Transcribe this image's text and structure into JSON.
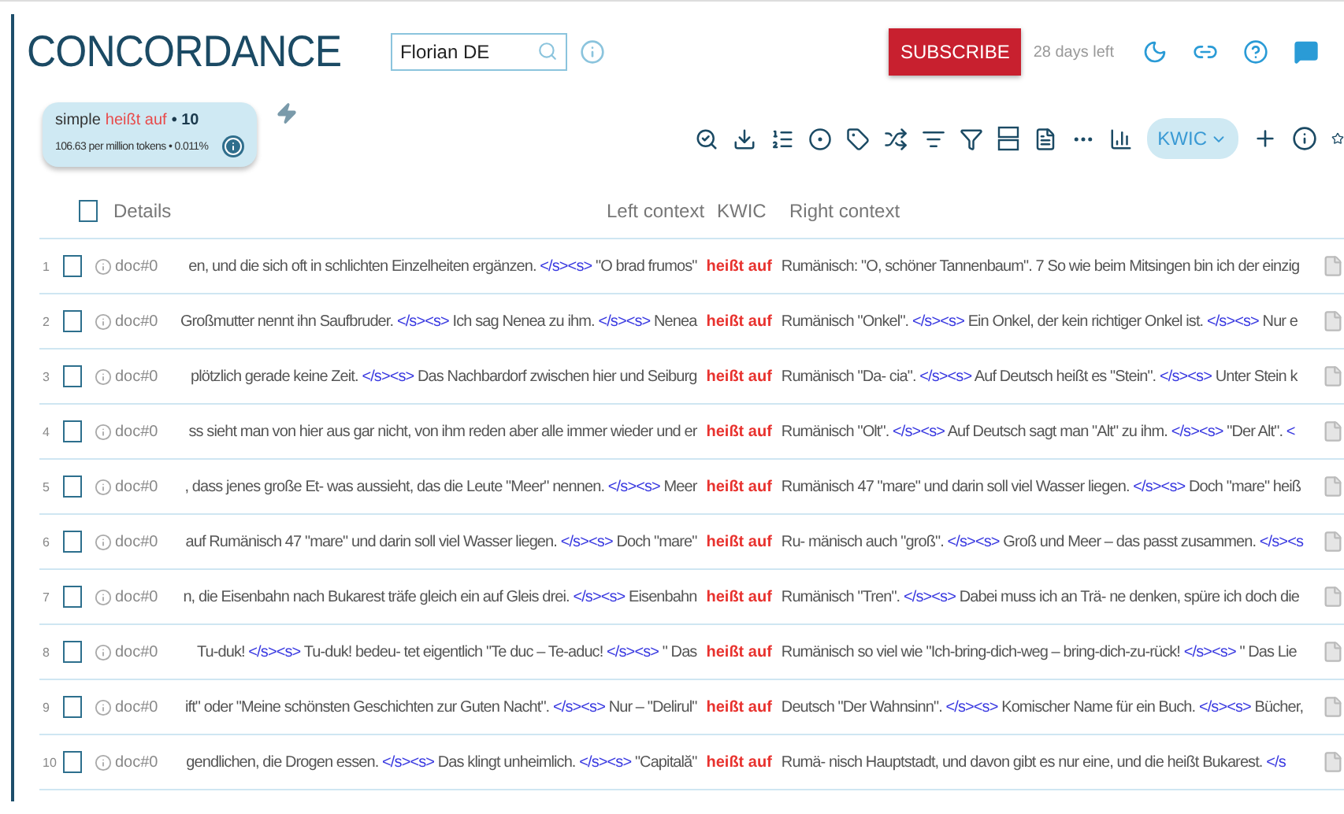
{
  "header": {
    "title": "CONCORDANCE",
    "search": {
      "value": "Florian DE"
    },
    "subscribe": "SUBSCRIBE",
    "trial": "28 days left"
  },
  "summary": {
    "query_type": "simple",
    "query": "heißt auf",
    "hits": "• 10",
    "stats": "106.63 per million tokens • 0.011%"
  },
  "view_mode": "KWIC",
  "table": {
    "columns": {
      "details": "Details",
      "left": "Left context",
      "kwic": "KWIC",
      "right": "Right context"
    },
    "select_all_checked": false,
    "rows": [
      {
        "number": "1",
        "checked": false,
        "doc": "doc#0",
        "left": [
          {
            "kind": "text",
            "text": "en, und die sich oft in schlichten Einzelheiten ergänzen."
          },
          {
            "kind": "tag",
            "text": "</s><s>"
          },
          {
            "kind": "text",
            "text": "\"O brad frumos\""
          }
        ],
        "kwic": "heißt auf",
        "right": [
          {
            "kind": "text",
            "text": "Rumänisch: \"O, schöner Tannenbaum\". 7 So wie beim Mitsingen bin ich der einzig"
          }
        ]
      },
      {
        "number": "2",
        "checked": false,
        "doc": "doc#0",
        "left": [
          {
            "kind": "text",
            "text": "Großmutter nennt ihn Saufbruder."
          },
          {
            "kind": "tag",
            "text": "</s><s>"
          },
          {
            "kind": "text",
            "text": "Ich sag Nenea zu ihm."
          },
          {
            "kind": "tag",
            "text": "</s><s>"
          },
          {
            "kind": "text",
            "text": "Nenea"
          }
        ],
        "kwic": "heißt auf",
        "right": [
          {
            "kind": "text",
            "text": "Rumänisch \"Onkel\"."
          },
          {
            "kind": "tag",
            "text": "</s><s>"
          },
          {
            "kind": "text",
            "text": "Ein Onkel, der kein richtiger Onkel ist."
          },
          {
            "kind": "tag",
            "text": "</s><s>"
          },
          {
            "kind": "text",
            "text": "Nur e"
          }
        ]
      },
      {
        "number": "3",
        "checked": false,
        "doc": "doc#0",
        "left": [
          {
            "kind": "text",
            "text": "plötzlich gerade keine Zeit."
          },
          {
            "kind": "tag",
            "text": "</s><s>"
          },
          {
            "kind": "text",
            "text": "Das Nachbardorf zwischen hier und Seiburg"
          }
        ],
        "kwic": "heißt auf",
        "right": [
          {
            "kind": "text",
            "text": "Rumänisch \"Da- cia\"."
          },
          {
            "kind": "tag",
            "text": "</s><s>"
          },
          {
            "kind": "text",
            "text": "Auf Deutsch heißt es \"Stein\"."
          },
          {
            "kind": "tag",
            "text": "</s><s>"
          },
          {
            "kind": "text",
            "text": "Unter Stein k"
          }
        ]
      },
      {
        "number": "4",
        "checked": false,
        "doc": "doc#0",
        "left": [
          {
            "kind": "text",
            "text": "ss sieht man von hier aus gar nicht, von ihm reden aber alle immer wieder und er"
          }
        ],
        "kwic": "heißt auf",
        "right": [
          {
            "kind": "text",
            "text": "Rumänisch \"Olt\"."
          },
          {
            "kind": "tag",
            "text": "</s><s>"
          },
          {
            "kind": "text",
            "text": "Auf Deutsch sagt man \"Alt\" zu ihm."
          },
          {
            "kind": "tag",
            "text": "</s><s>"
          },
          {
            "kind": "text",
            "text": "\"Der Alt\"."
          },
          {
            "kind": "tag",
            "text": "<"
          }
        ]
      },
      {
        "number": "5",
        "checked": false,
        "doc": "doc#0",
        "left": [
          {
            "kind": "text",
            "text": ", dass jenes große Et- was aussieht, das die Leute \"Meer\" nennen."
          },
          {
            "kind": "tag",
            "text": "</s><s>"
          },
          {
            "kind": "text",
            "text": "Meer"
          }
        ],
        "kwic": "heißt auf",
        "right": [
          {
            "kind": "text",
            "text": "Rumänisch 47 \"mare\" und darin soll viel Wasser liegen."
          },
          {
            "kind": "tag",
            "text": "</s><s>"
          },
          {
            "kind": "text",
            "text": "Doch \"mare\" heiß"
          }
        ]
      },
      {
        "number": "6",
        "checked": false,
        "doc": "doc#0",
        "left": [
          {
            "kind": "text",
            "text": "auf Rumänisch 47 \"mare\" und darin soll viel Wasser liegen."
          },
          {
            "kind": "tag",
            "text": "</s><s>"
          },
          {
            "kind": "text",
            "text": "Doch \"mare\""
          }
        ],
        "kwic": "heißt auf",
        "right": [
          {
            "kind": "text",
            "text": "Ru- mänisch auch \"groß\"."
          },
          {
            "kind": "tag",
            "text": "</s><s>"
          },
          {
            "kind": "text",
            "text": "Groß und Meer – das passt zusammen."
          },
          {
            "kind": "tag",
            "text": "</s><s"
          }
        ]
      },
      {
        "number": "7",
        "checked": false,
        "doc": "doc#0",
        "left": [
          {
            "kind": "text",
            "text": "n, die Eisenbahn nach Bukarest träfe gleich ein auf Gleis drei."
          },
          {
            "kind": "tag",
            "text": "</s><s>"
          },
          {
            "kind": "text",
            "text": "Eisenbahn"
          }
        ],
        "kwic": "heißt auf",
        "right": [
          {
            "kind": "text",
            "text": "Rumänisch \"Tren\"."
          },
          {
            "kind": "tag",
            "text": "</s><s>"
          },
          {
            "kind": "text",
            "text": "Dabei muss ich an Trä- ne denken, spüre ich doch die"
          }
        ]
      },
      {
        "number": "8",
        "checked": false,
        "doc": "doc#0",
        "left": [
          {
            "kind": "text",
            "text": "Tu-duk!"
          },
          {
            "kind": "tag",
            "text": "</s><s>"
          },
          {
            "kind": "text",
            "text": "Tu-duk! bedeu- tet eigentlich \"Te duc – Te-aduc!"
          },
          {
            "kind": "tag",
            "text": "</s><s>"
          },
          {
            "kind": "text",
            "text": "\" Das"
          }
        ],
        "kwic": "heißt auf",
        "right": [
          {
            "kind": "text",
            "text": "Rumänisch so viel wie \"Ich-bring-dich-weg – bring-dich-zu-rück!"
          },
          {
            "kind": "tag",
            "text": "</s><s>"
          },
          {
            "kind": "text",
            "text": "\" Das Lie"
          }
        ]
      },
      {
        "number": "9",
        "checked": false,
        "doc": "doc#0",
        "left": [
          {
            "kind": "text",
            "text": "ift\" oder \"Meine schönsten Geschichten zur Guten Nacht\"."
          },
          {
            "kind": "tag",
            "text": "</s><s>"
          },
          {
            "kind": "text",
            "text": "Nur – \"Delirul\""
          }
        ],
        "kwic": "heißt auf",
        "right": [
          {
            "kind": "text",
            "text": "Deutsch \"Der Wahnsinn\"."
          },
          {
            "kind": "tag",
            "text": "</s><s>"
          },
          {
            "kind": "text",
            "text": "Komischer Name für ein Buch."
          },
          {
            "kind": "tag",
            "text": "</s><s>"
          },
          {
            "kind": "text",
            "text": "Bücher,"
          }
        ]
      },
      {
        "number": "10",
        "checked": false,
        "doc": "doc#0",
        "left": [
          {
            "kind": "text",
            "text": "gendlichen, die Drogen essen."
          },
          {
            "kind": "tag",
            "text": "</s><s>"
          },
          {
            "kind": "text",
            "text": "Das klingt unheimlich."
          },
          {
            "kind": "tag",
            "text": "</s><s>"
          },
          {
            "kind": "text",
            "text": "\"Capitală\""
          }
        ],
        "kwic": "heißt auf",
        "right": [
          {
            "kind": "text",
            "text": "Rumä- nisch Hauptstadt, und davon gibt es nur eine, und die heißt Bukarest."
          },
          {
            "kind": "tag",
            "text": "</s"
          }
        ]
      }
    ]
  }
}
